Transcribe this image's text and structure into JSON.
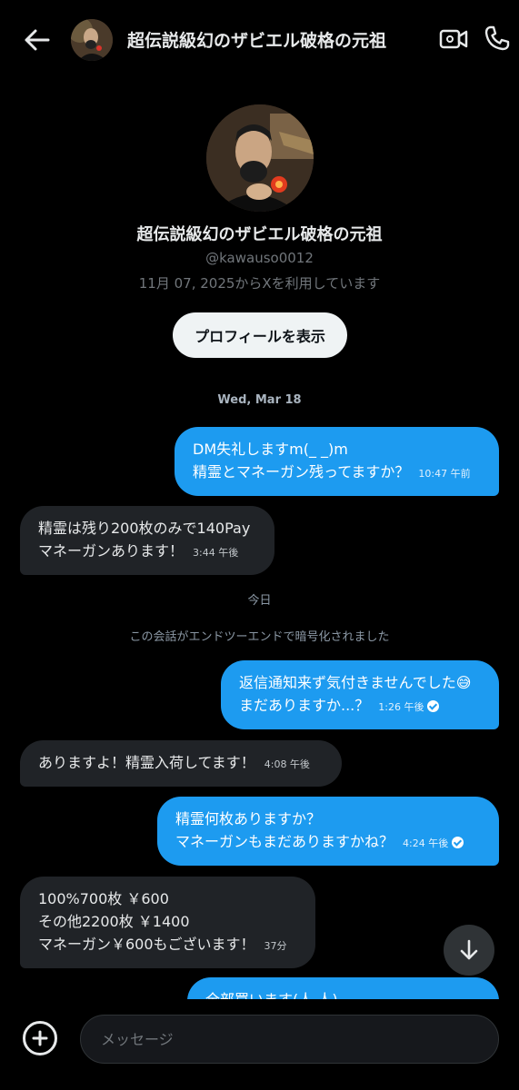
{
  "header": {
    "title": "超伝説級幻のザビエル破格の元祖",
    "back_icon": "arrow-left-icon",
    "video_icon": "video-call-icon",
    "phone_icon": "phone-call-icon"
  },
  "profile": {
    "name": "超伝説級幻のザビエル破格の元祖",
    "handle": "@kawauso0012",
    "joined": "11月 07, 2025からXを利用しています",
    "view_profile_label": "プロフィールを表示"
  },
  "separators": {
    "date1": "Wed, Mar 18",
    "today": "今日",
    "encrypted_notice": "この会話がエンドツーエンドで暗号化されました"
  },
  "messages": [
    {
      "direction": "out",
      "lines": [
        "DM失礼しますm(_ _)m",
        "精霊とマネーガン残ってますか？"
      ],
      "time": "10:47 午前",
      "read": false
    },
    {
      "direction": "in",
      "lines": [
        "精霊は残り200枚のみで140Pay",
        "マネーガンあります！"
      ],
      "time": "3:44 午後"
    },
    {
      "direction": "out",
      "lines": [
        "返信通知来ず気付きませんでした😅",
        "まだありますか...？"
      ],
      "time": "1:26 午後",
      "read": true
    },
    {
      "direction": "in",
      "lines": [
        "ありますよ！精霊入荷してます！"
      ],
      "time": "4:08 午後"
    },
    {
      "direction": "out",
      "lines": [
        "精霊何枚ありますか？",
        "マネーガンもまだありますかね？"
      ],
      "time": "4:24 午後",
      "read": true
    },
    {
      "direction": "in",
      "lines": [
        "100%700枚 ￥600",
        "その他2200枚 ￥1400",
        "マネーガン￥600もございます！"
      ],
      "time": "37分"
    },
    {
      "direction": "out",
      "lines": [
        "全部買います(人 人)"
      ],
      "time": ""
    }
  ],
  "composer": {
    "placeholder": "メッセージ",
    "add_icon": "add-circle-icon"
  },
  "scroll_down_icon": "arrow-down-icon",
  "colors": {
    "background": "#000000",
    "outgoing_bubble": "#1d9bf0",
    "incoming_bubble": "#202327",
    "muted_text": "#71767b"
  }
}
